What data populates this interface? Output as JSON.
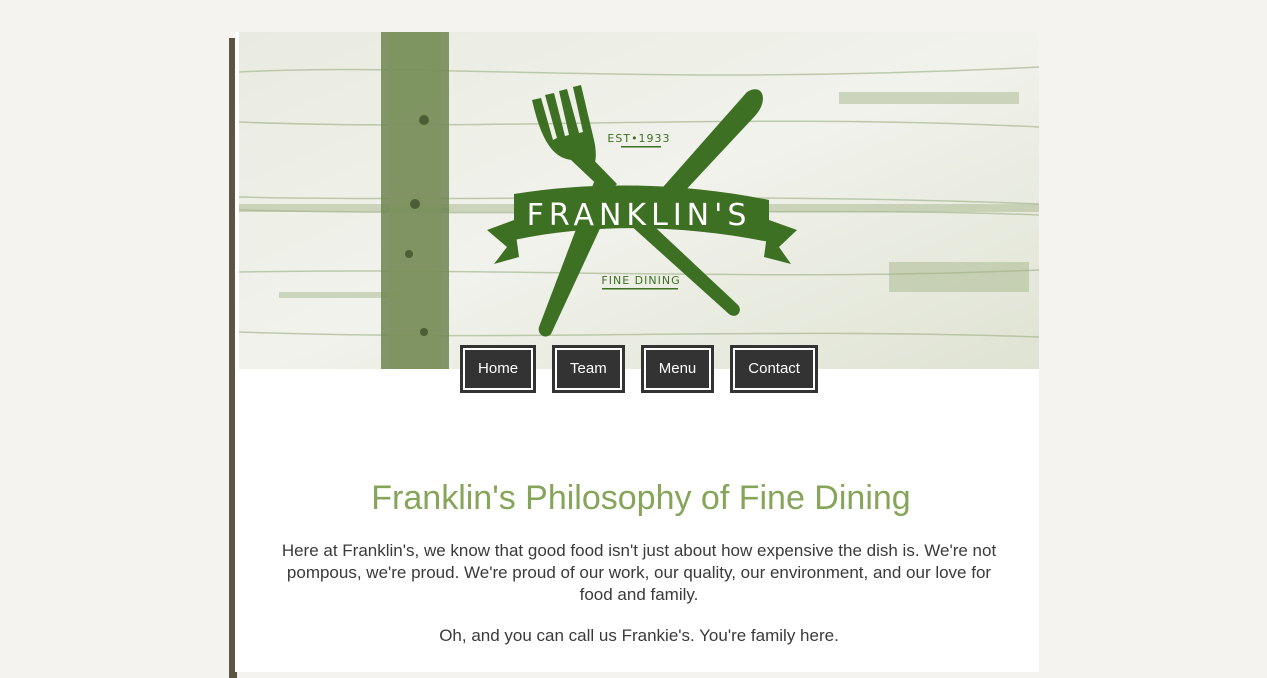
{
  "brand": {
    "name": "FRANKLIN'S",
    "established": "EST•1933",
    "tagline": "FINE DINING",
    "colors": {
      "logo_green": "#3d7023",
      "heading_green": "#86a55a",
      "nav_bg": "#333333"
    }
  },
  "nav": {
    "items": [
      {
        "label": "Home"
      },
      {
        "label": "Team"
      },
      {
        "label": "Menu"
      },
      {
        "label": "Contact"
      }
    ]
  },
  "main": {
    "title": "Franklin's Philosophy of Fine Dining",
    "paragraphs": [
      "Here at Franklin's, we know that good food isn't just about how expensive the dish is. We're not pompous, we're proud. We're proud of our work, our quality, our environment, and our love for food and family.",
      "Oh, and you can call us Frankie's. You're family here."
    ]
  }
}
